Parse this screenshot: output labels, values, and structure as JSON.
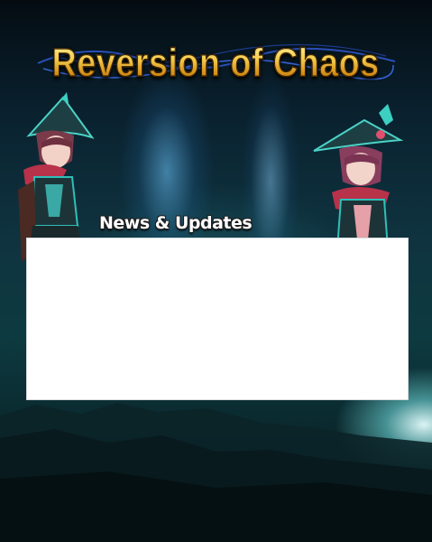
{
  "header": {
    "title": "Reversion of Chaos",
    "ornament_icon": "swirl-ornament-icon"
  },
  "news": {
    "heading": "News & Updates",
    "content": ""
  },
  "artwork": {
    "left_character": "character-left-icon",
    "right_character": "character-right-icon",
    "background": "night-sky-landscape"
  },
  "colors": {
    "title_gold": "#f1c24a",
    "panel_bg": "#ffffff",
    "accent_teal": "#2fbfb8",
    "accent_pink": "#e0506e"
  }
}
